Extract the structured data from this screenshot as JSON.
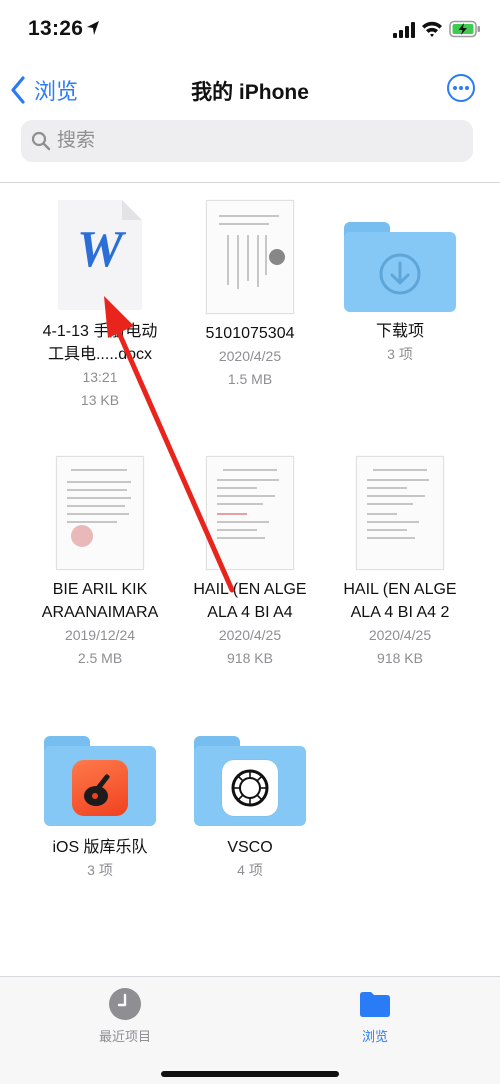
{
  "status_bar": {
    "time": "13:26"
  },
  "nav": {
    "back_label": "浏览",
    "title": "我的 iPhone"
  },
  "search": {
    "placeholder": "搜索"
  },
  "items": [
    {
      "name": "4-1-13 手册电动",
      "name_line2": "工具电.....docx",
      "meta1": "13:21",
      "meta2": "13 KB",
      "kind": "word-document",
      "icon": "word-doc-icon",
      "badge_letter": "W"
    },
    {
      "name": "5101075304",
      "meta1": "2020/4/25",
      "meta2": "1.5 MB",
      "kind": "scanned-document"
    },
    {
      "name": "下载项",
      "meta1": "3 项",
      "kind": "folder",
      "icon": "download-icon"
    },
    {
      "name": "BIE ARIL KIK",
      "name_line2": "ARAANAIMARA",
      "meta1": "2019/12/24",
      "meta2": "2.5 MB",
      "kind": "scanned-document"
    },
    {
      "name": "HAIL (EN ALGE",
      "name_line2": "ALA  4 BI A4",
      "meta1": "2020/4/25",
      "meta2": "918 KB",
      "kind": "scanned-document"
    },
    {
      "name": "HAIL (EN ALGE",
      "name_line2": "ALA  4 BI A4 2",
      "meta1": "2020/4/25",
      "meta2": "918 KB",
      "kind": "scanned-document"
    },
    {
      "name": "iOS 版库乐队",
      "meta1": "3 项",
      "kind": "app-folder",
      "icon": "garageband-icon"
    },
    {
      "name": "VSCO",
      "meta1": "4 项",
      "kind": "app-folder",
      "icon": "vsco-icon"
    }
  ],
  "tab_bar": {
    "recents_label": "最近项目",
    "browse_label": "浏览"
  },
  "colors": {
    "accent": "#2a7cf6",
    "folder": "#86c8f5",
    "annotation_arrow": "#e8241c",
    "word_blue": "#2b6fd6"
  }
}
